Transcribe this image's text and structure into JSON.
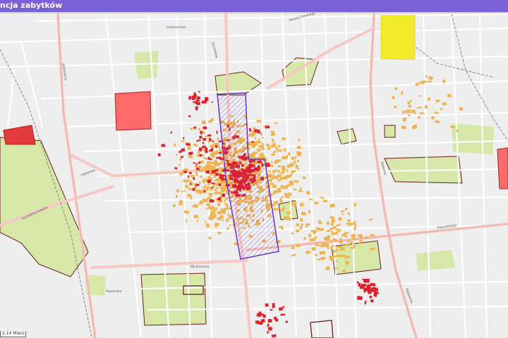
{
  "app": {
    "title": "ncja zabytków"
  },
  "map": {
    "scale_text": "2.14 Mierz",
    "colors": {
      "background": "#eeeeee",
      "road_major": "#f8c7c3",
      "road_minor": "#ffffff",
      "park": "#d6e8a8",
      "monument_red": "#e0202c",
      "monument_orange": "#f0b24a",
      "protected_zone": "#6633cc",
      "yellow_area": "#f2ea2a"
    },
    "street_labels": [
      "Lutomierska",
      "Wojska Polskiego",
      "Zachodnia",
      "Konstantynowska",
      "Mickiewicza",
      "Piłsudskiego",
      "Rzgowska",
      "Kopernika",
      "Legionów",
      "Włókniarzy",
      "Zgierska"
    ]
  }
}
